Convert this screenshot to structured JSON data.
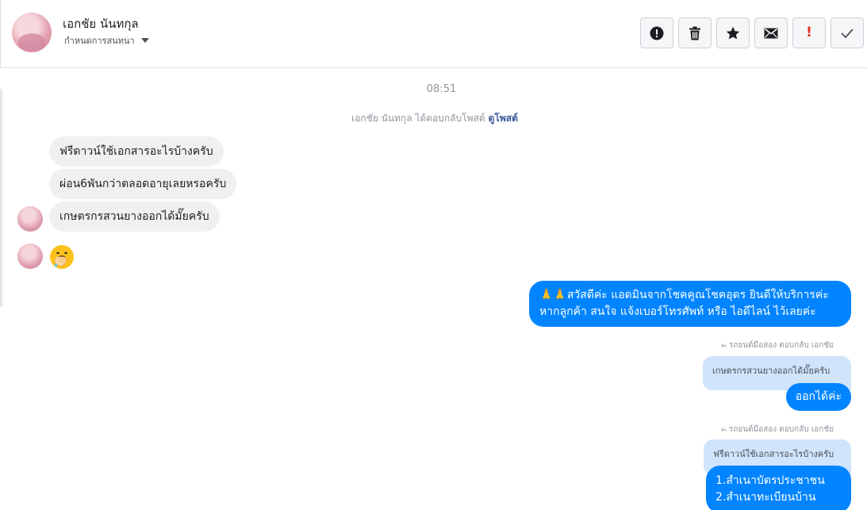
{
  "header": {
    "contact_name": "เอกชัย นันทกุล",
    "assign_label": "กำหนดการสนทนา",
    "actions": {
      "spam": "exclamation-circle-icon",
      "delete": "trash-icon",
      "star": "star-icon",
      "unread": "envelope-icon",
      "follow_up": "!",
      "done": "check-icon"
    }
  },
  "conversation": {
    "timestamp": "08:51",
    "reply_notice": "เอกชัย นันทกุล ได้ตอบกลับโพสต์",
    "view_post_label": "ดูโพสต์",
    "incoming": [
      "ฟรีดาวน์ใช้เอกสารอะไรบ้างครับ",
      "ผ่อน6พันกว่าตลอดอายุเลยหรอครับ",
      "เกษตรกรสวนยางออกได้มั๊ยครับ"
    ],
    "incoming_emoji": "face-with-hand-over-mouth-icon",
    "outgoing_greeting": {
      "line1": "🙏🙏สวัสดีค่ะ แอดมินจากโชคคูณโชคอุดร ยินดีให้บริการค่ะ",
      "line2": "หากลูกค้า สนใจ แจ้งเบอร์โทรศัพท์ หรือ ไอดีไลน์  ไว้เลยค่ะ"
    },
    "replies": [
      {
        "meta": "รถยนต์มือสอง ตอบกลับ เอกชัย",
        "quote": "เกษตรกรสวนยางออกได้มั๊ยครับ",
        "answer": "ออกได้ค่ะ"
      },
      {
        "meta": "รถยนต์มือสอง ตอบกลับ เอกชัย",
        "quote": "ฟรีดาวน์ใช้เอกสารอะไรบ้างครับ",
        "answer_lines": [
          "1.สำเนาบัตรประชาชน",
          "2.สำเนาทะเบียนบ้าน"
        ]
      }
    ]
  },
  "colors": {
    "outgoing": "#0084ff",
    "incoming": "#f1f0f0",
    "quote": "#d0e4fb",
    "link": "#385898"
  }
}
